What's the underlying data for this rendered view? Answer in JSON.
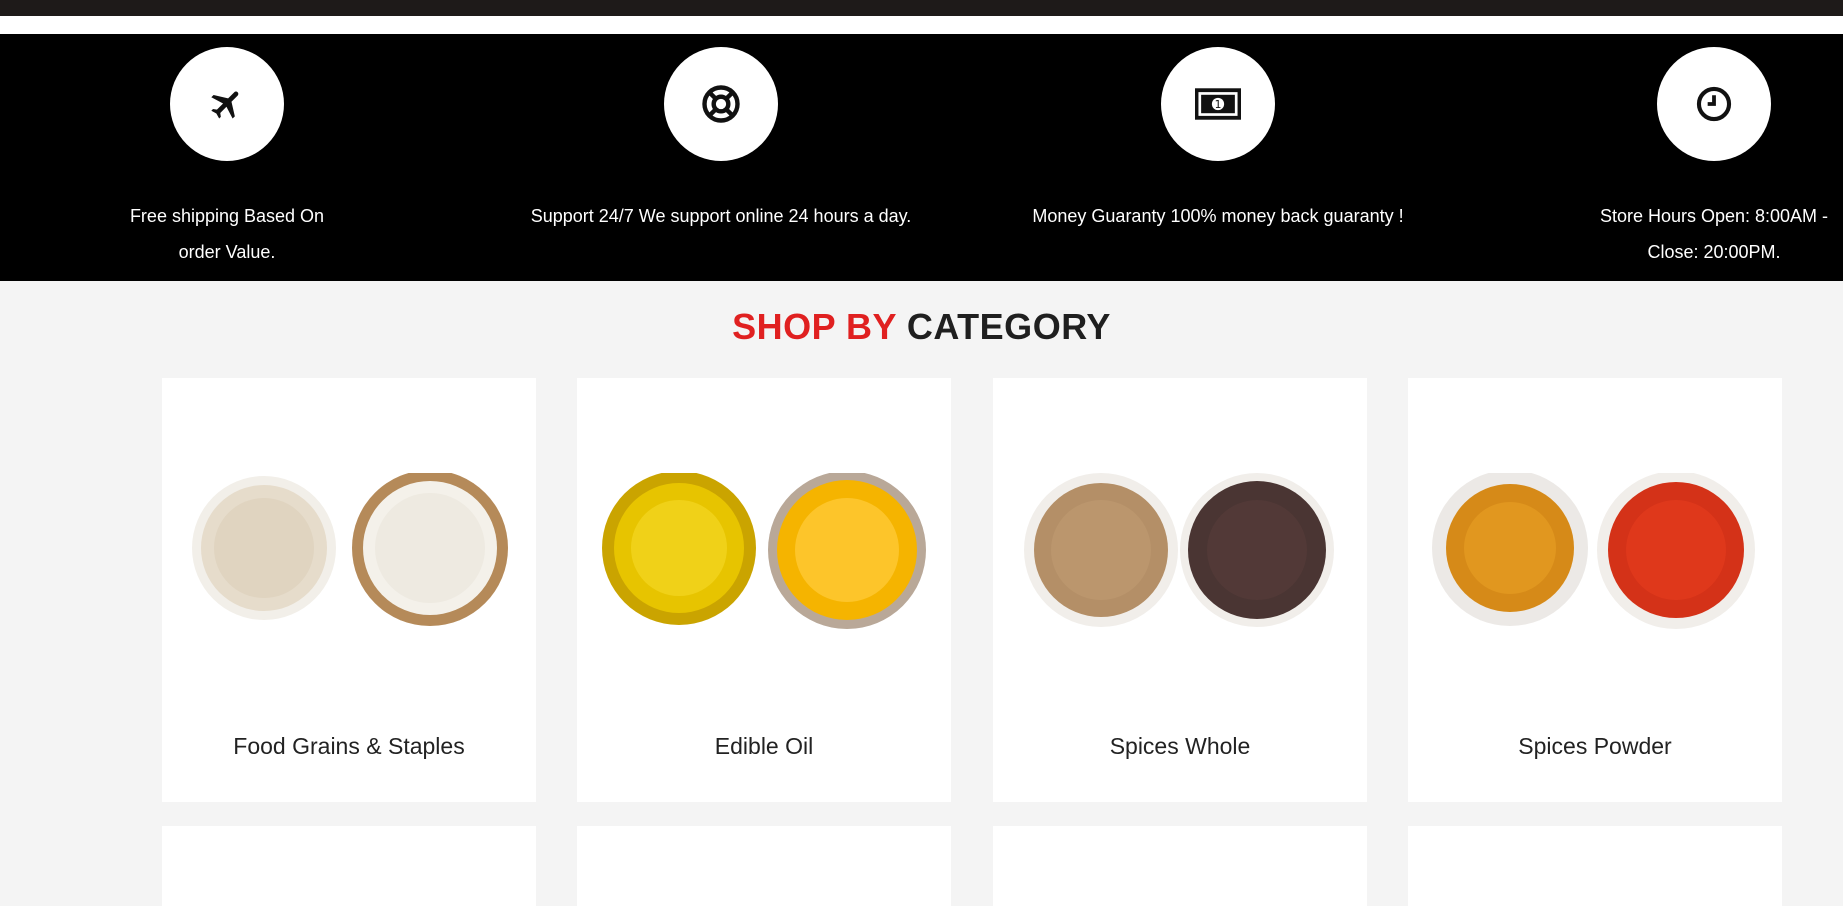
{
  "features": [
    {
      "icon": "airplane-icon",
      "lines": [
        "Free shipping Based On",
        "order Value."
      ]
    },
    {
      "icon": "lifebuoy-icon",
      "lines": [
        "Support 24/7 We support online 24 hours a day."
      ]
    },
    {
      "icon": "money-icon",
      "lines": [
        "Money Guaranty 100% money back guaranty !"
      ]
    },
    {
      "icon": "clock-icon",
      "lines": [
        "Store Hours Open: 8:00AM -",
        "Close: 20:00PM."
      ]
    }
  ],
  "section": {
    "title_highlight": "SHOP BY",
    "title_rest": "CATEGORY"
  },
  "categories": [
    {
      "label": "Food Grains & Staples"
    },
    {
      "label": "Edible Oil"
    },
    {
      "label": "Spices Whole"
    },
    {
      "label": "Spices Powder"
    }
  ],
  "colors": {
    "accent": "#e02020",
    "band": "#000000",
    "background": "#f4f4f4"
  }
}
